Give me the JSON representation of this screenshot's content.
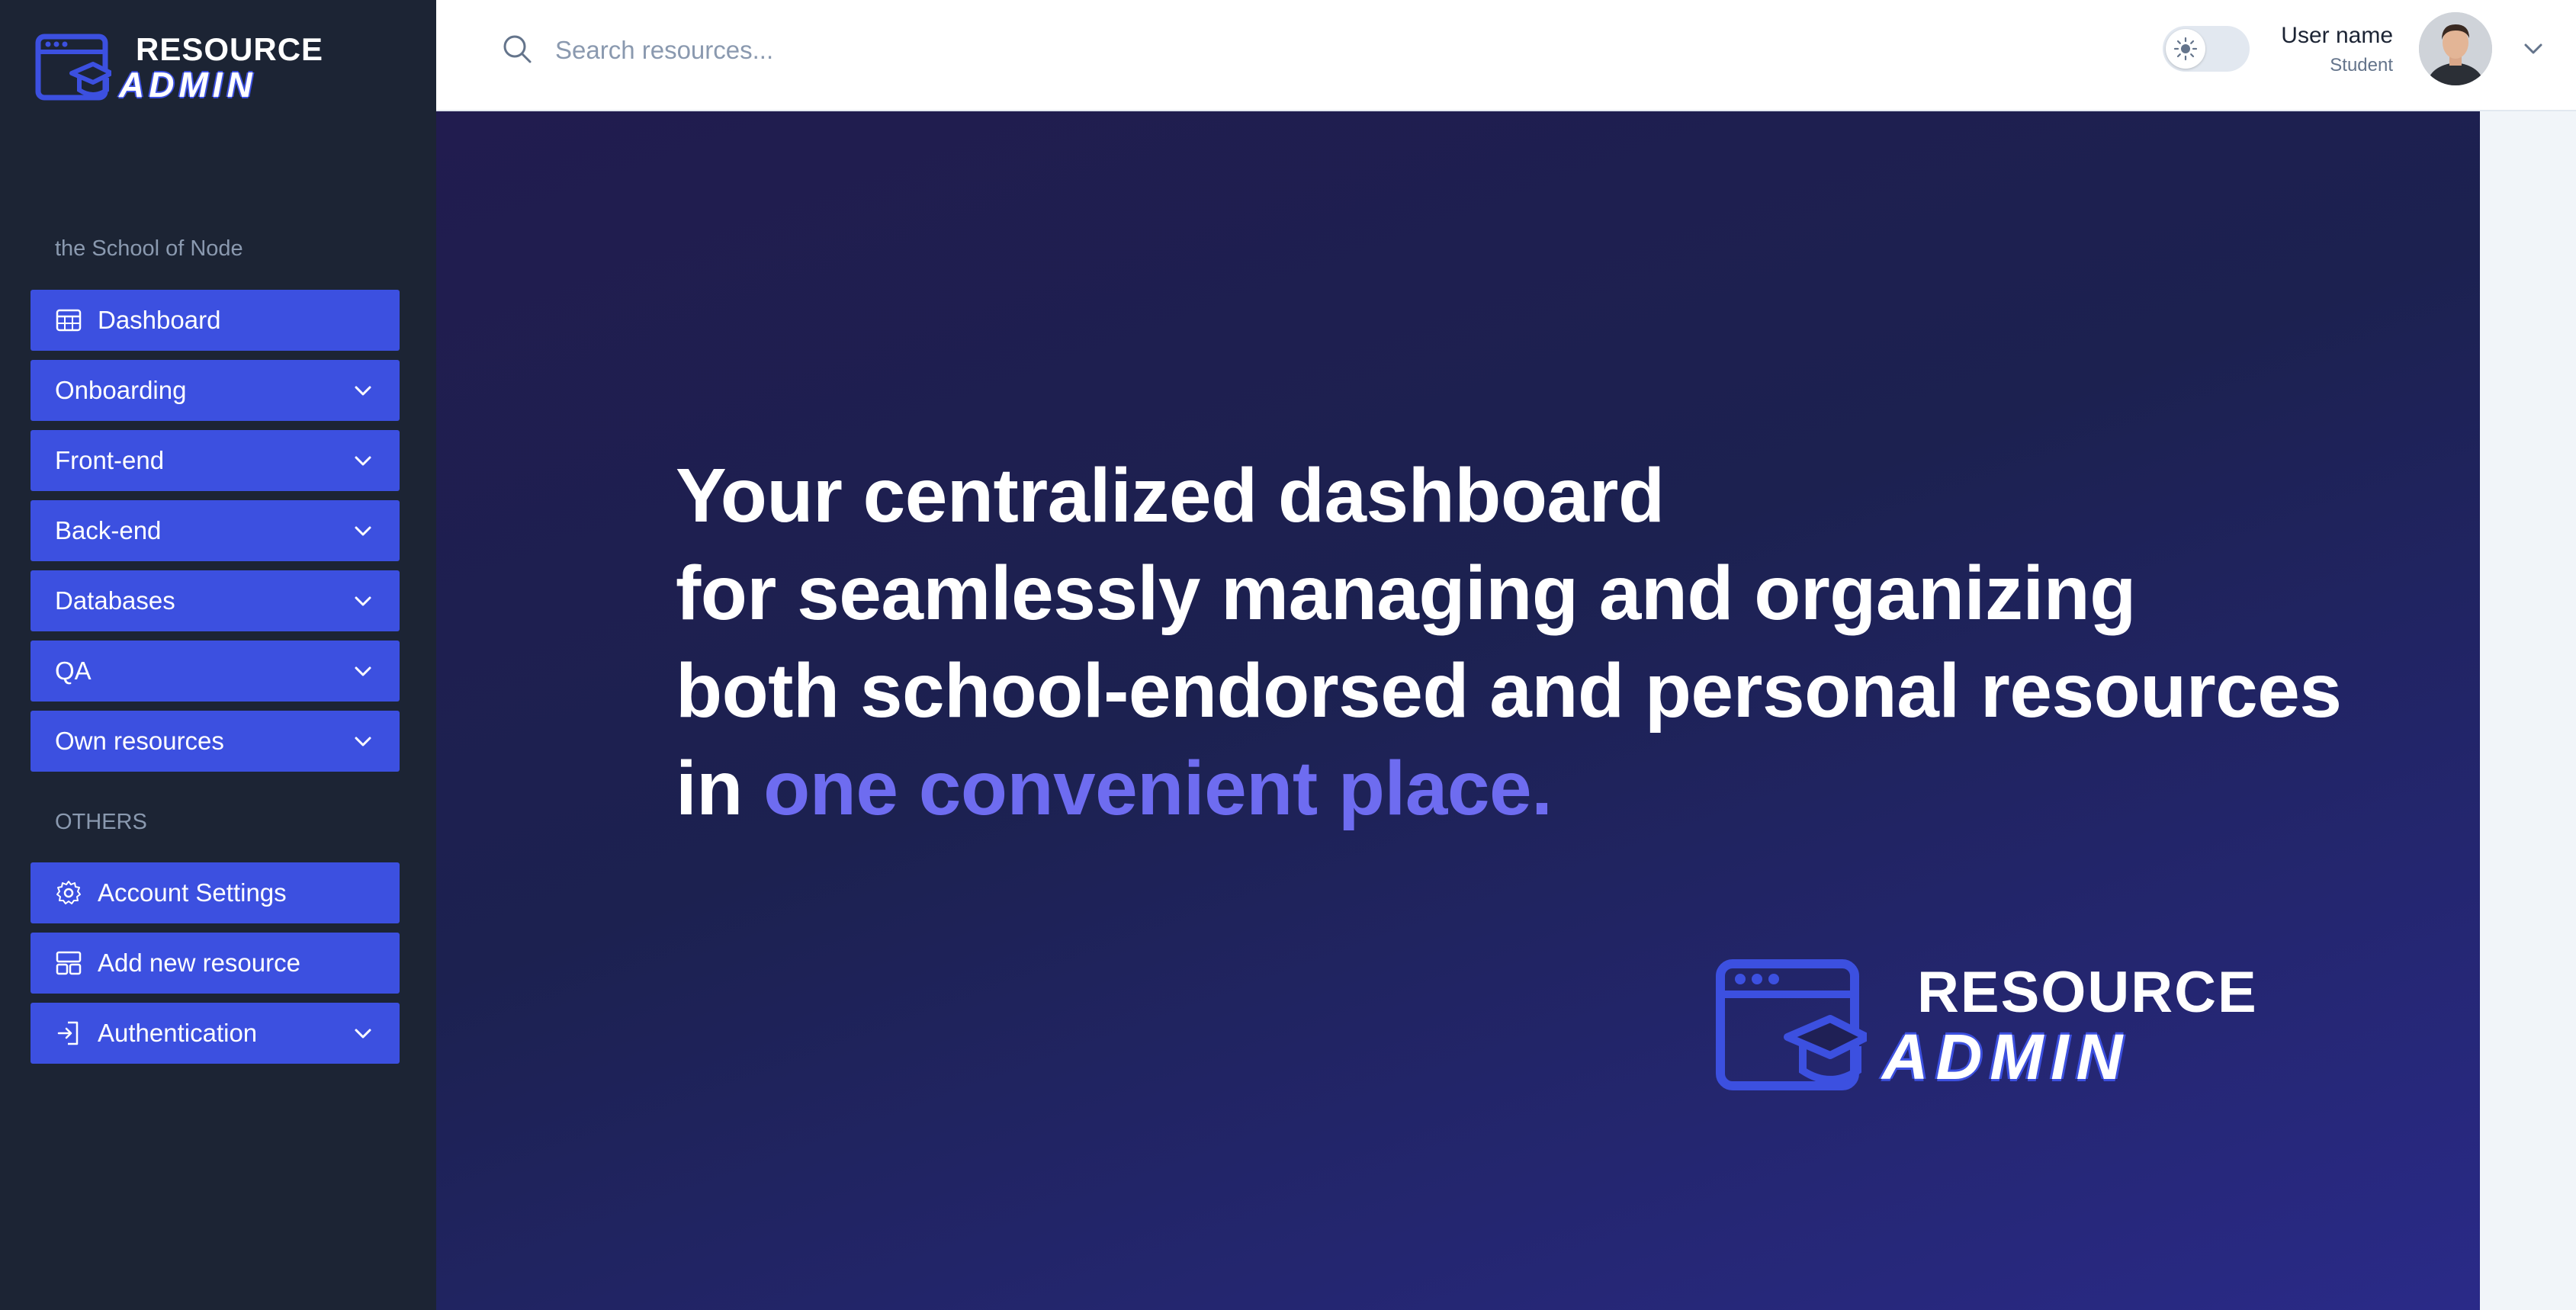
{
  "brand": {
    "line1": "RESOURCE",
    "line2": "ADMIN",
    "accent_color": "#3c50e0"
  },
  "sidebar": {
    "section_main": "the School of Node",
    "items": [
      {
        "label": "Dashboard",
        "icon": "calendar-icon",
        "expandable": false
      },
      {
        "label": "Onboarding",
        "expandable": true
      },
      {
        "label": "Front-end",
        "expandable": true
      },
      {
        "label": "Back-end",
        "expandable": true
      },
      {
        "label": "Databases",
        "expandable": true
      },
      {
        "label": "QA",
        "expandable": true
      },
      {
        "label": "Own resources",
        "expandable": true
      }
    ],
    "section_others": "OTHERS",
    "others": [
      {
        "label": "Account Settings",
        "icon": "gear-icon",
        "expandable": false
      },
      {
        "label": "Add new resource",
        "icon": "layout-icon",
        "expandable": false
      },
      {
        "label": "Authentication",
        "icon": "login-icon",
        "expandable": true
      }
    ]
  },
  "header": {
    "search_placeholder": "Search resources...",
    "theme_toggle": "light",
    "user_name": "User name",
    "user_role": "Student"
  },
  "hero": {
    "line1": "Your centralized dashboard",
    "line2": "for seamlessly managing and organizing",
    "line3": "both school-endorsed and personal resources",
    "line4_prefix": "in",
    "line4_accent": "one convenient place."
  }
}
